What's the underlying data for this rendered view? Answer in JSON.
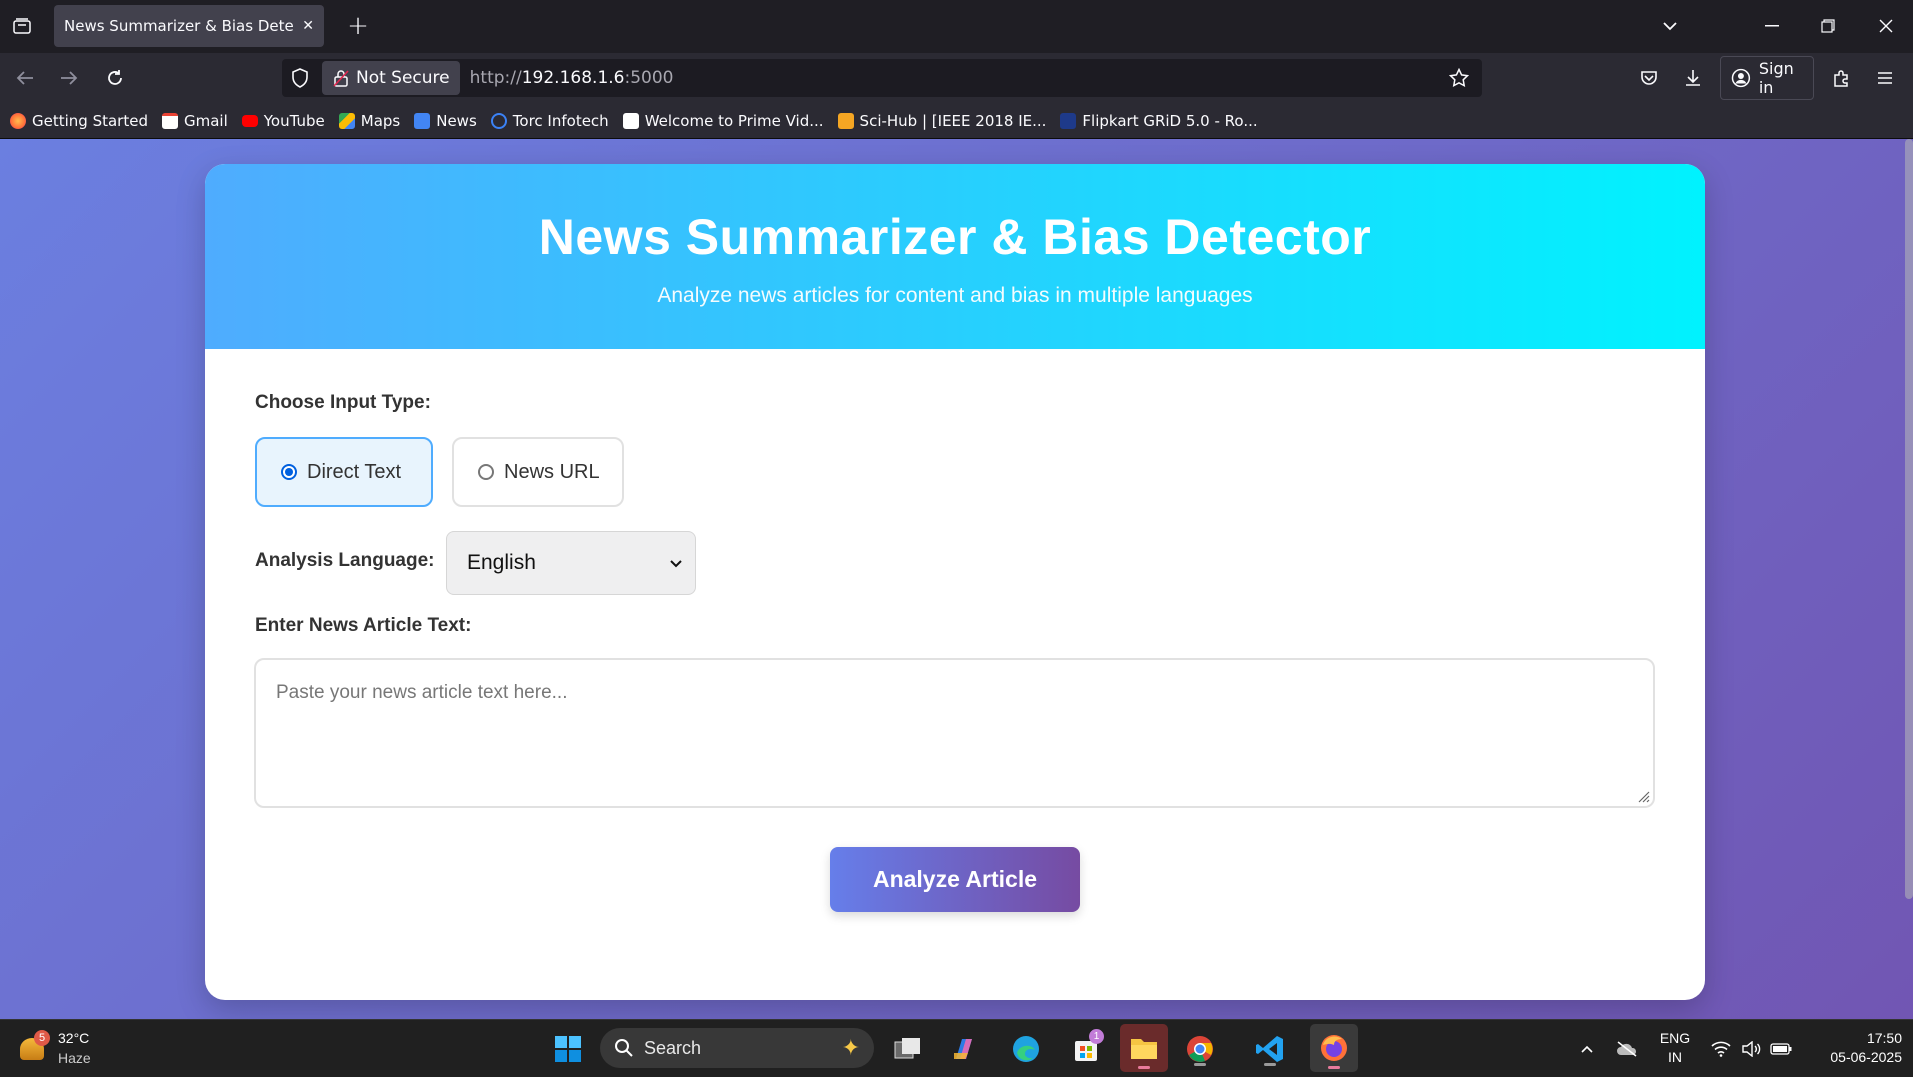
{
  "browser": {
    "tab_title": "News Summarizer & Bias Detector",
    "tab_close_glyph": "✕",
    "new_tab_glyph": "+",
    "security_label": "Not Secure",
    "url_scheme": "http://",
    "url_host": "192.168.1.6",
    "url_port": ":5000",
    "sign_in_label": "Sign in",
    "bookmarks": [
      {
        "label": "Getting Started",
        "color": "#ff7139"
      },
      {
        "label": "Gmail",
        "color": "#ea4335"
      },
      {
        "label": "YouTube",
        "color": "#ff0000"
      },
      {
        "label": "Maps",
        "color": "#34a853"
      },
      {
        "label": "News",
        "color": "#4285f4"
      },
      {
        "label": "Torc Infotech",
        "color": "#3b82f6"
      },
      {
        "label": "Welcome to Prime Vid...",
        "color": "#ffffff"
      },
      {
        "label": "Sci-Hub | [IEEE 2018 IE...",
        "color": "#f5a623"
      },
      {
        "label": "Flipkart GRiD 5.0 - Ro...",
        "color": "#1e3a8a"
      }
    ]
  },
  "app": {
    "title": "News Summarizer & Bias Detector",
    "subtitle": "Analyze news articles for content and bias in multiple languages",
    "input_type_label": "Choose Input Type:",
    "input_types": [
      {
        "label": "Direct Text",
        "selected": true
      },
      {
        "label": "News URL",
        "selected": false
      }
    ],
    "language_label": "Analysis Language:",
    "language_value": "English",
    "text_label": "Enter News Article Text:",
    "text_placeholder": "Paste your news article text here...",
    "analyze_label": "Analyze Article",
    "colors": {
      "header_start": "#4facfe",
      "header_end": "#00f2fe",
      "button_start": "#667eea",
      "button_end": "#764ba2"
    }
  },
  "taskbar": {
    "weather_temp": "32°C",
    "weather_desc": "Haze",
    "weather_badge": "5",
    "search_label": "Search",
    "store_badge": "1",
    "language_line1": "ENG",
    "language_line2": "IN",
    "time": "17:50",
    "date": "05-06-2025"
  }
}
